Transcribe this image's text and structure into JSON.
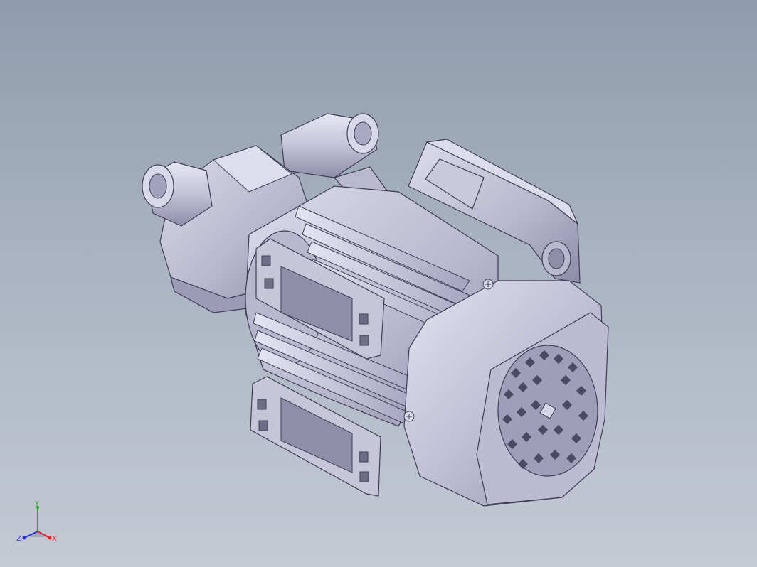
{
  "colors": {
    "background_top": "#8f9cad",
    "background_bottom": "#c4cad4",
    "part_light": "#d2d1e4",
    "part_mid": "#b2b1c9",
    "part_dark": "#8f8ea8",
    "edge": "#3f3e55",
    "axis_x": "#d42a2a",
    "axis_y": "#2aa52a",
    "axis_z": "#2a35c8"
  },
  "triad": {
    "x_label": "X",
    "y_label": "Y",
    "z_label": "Z"
  }
}
